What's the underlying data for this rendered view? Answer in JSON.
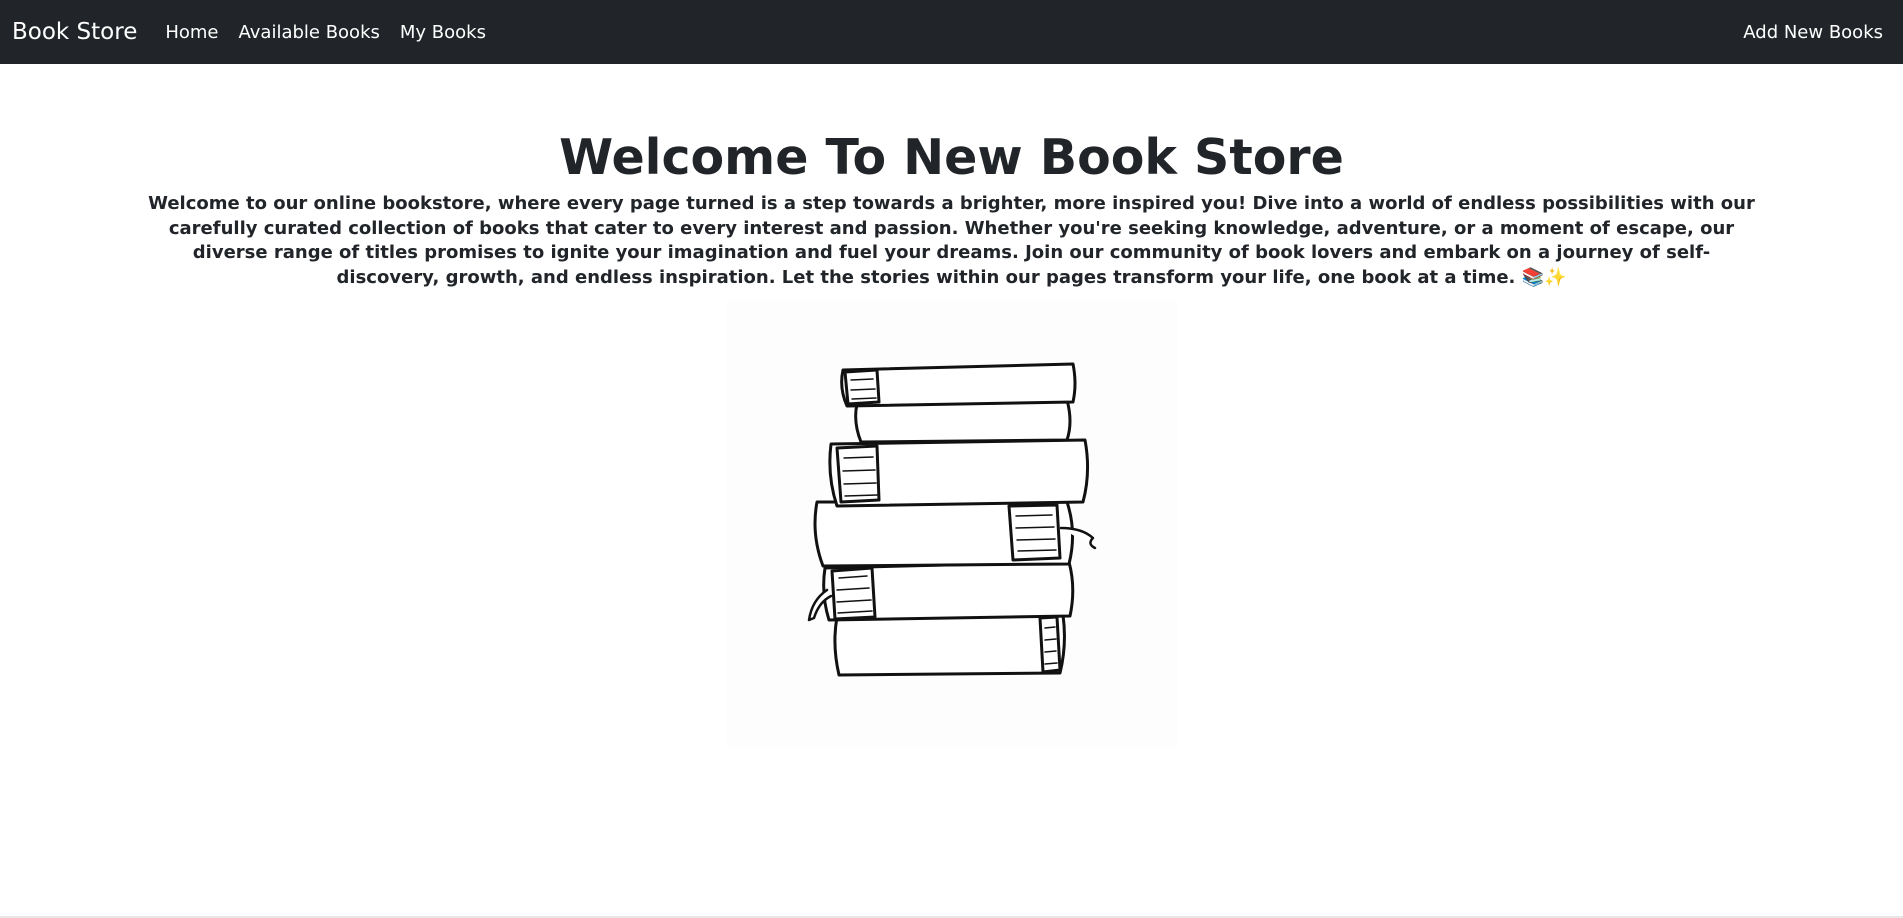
{
  "navbar": {
    "brand": "Book Store",
    "links": [
      "Home",
      "Available Books",
      "My Books"
    ],
    "right_link": "Add New Books",
    "background": "#212529"
  },
  "main": {
    "title": "Welcome To New Book Store",
    "intro": "Welcome to our online bookstore, where every page turned is a step towards a brighter, more inspired you! Dive into a world of endless possibilities with our carefully curated collection of books that cater to every interest and passion. Whether you're seeking knowledge, adventure, or a moment of escape, our diverse range of titles promises to ignite your imagination and fuel your dreams. Join our community of book lovers and embark on a journey of self-discovery, growth, and endless inspiration. Let the stories within our pages transform your life, one book at a time. 📚✨",
    "image_icon": "book-stack-illustration"
  }
}
